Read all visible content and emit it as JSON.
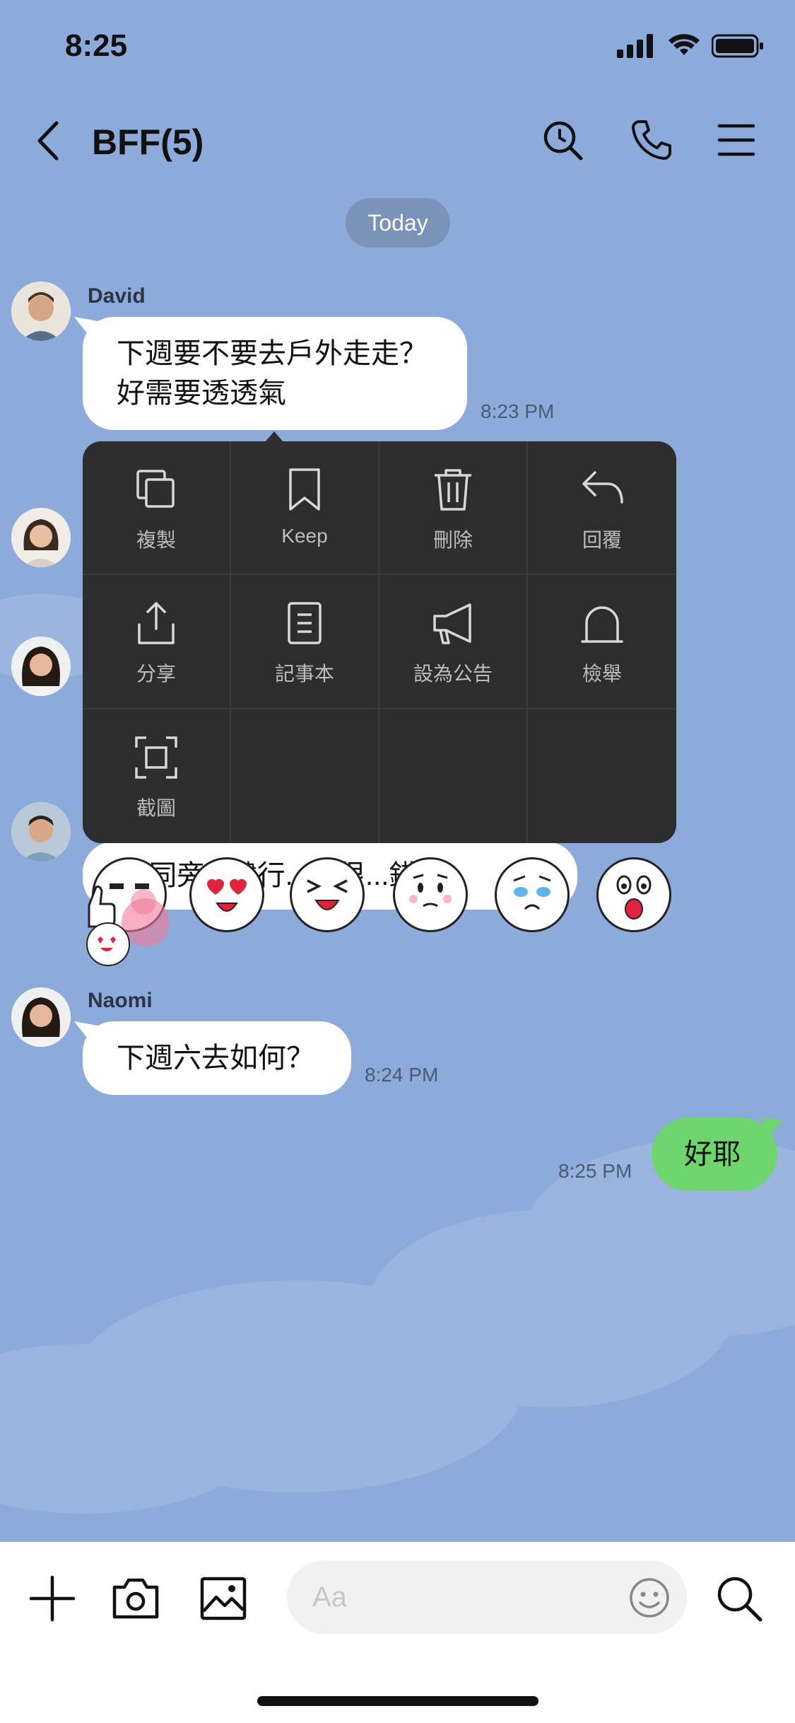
{
  "status": {
    "time": "8:25"
  },
  "header": {
    "title": "BFF(5)"
  },
  "date_pill": "Today",
  "messages": [
    {
      "sender": "David",
      "lines": [
        "下週要不要去戶外走走？",
        "好需要透透氣"
      ],
      "time": "8:23 PM"
    },
    {
      "partial_text": "...同旁...健行...就很...錯呀"
    },
    {
      "sender": "Naomi",
      "text": "下週六去如何？",
      "time": "8:24 PM"
    },
    {
      "own": true,
      "text": "好耶",
      "time": "8:25 PM"
    }
  ],
  "context_menu": {
    "items": [
      {
        "label": "複製",
        "icon": "copy-icon"
      },
      {
        "label": "Keep",
        "icon": "bookmark-icon"
      },
      {
        "label": "刪除",
        "icon": "trash-icon"
      },
      {
        "label": "回覆",
        "icon": "reply-icon"
      },
      {
        "label": "分享",
        "icon": "share-icon"
      },
      {
        "label": "記事本",
        "icon": "notes-icon"
      },
      {
        "label": "設為公告",
        "icon": "megaphone-icon"
      },
      {
        "label": "檢舉",
        "icon": "report-icon"
      },
      {
        "label": "截圖",
        "icon": "screenshot-icon"
      }
    ]
  },
  "reactions": [
    "thumbs-up-sticker",
    "heart-eyes-sticker",
    "laughing-sticker",
    "thinking-sticker",
    "crying-sticker",
    "surprised-sticker"
  ],
  "input": {
    "placeholder": "Aa"
  },
  "colors": {
    "background": "#8cabda",
    "own_bubble": "#6fd56f",
    "menu": "#2d2d2d"
  }
}
